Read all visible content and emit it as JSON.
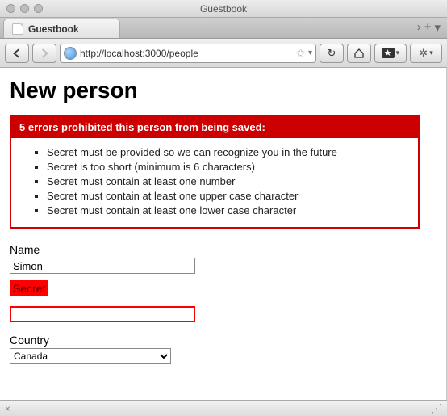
{
  "window": {
    "title": "Guestbook"
  },
  "tab": {
    "label": "Guestbook"
  },
  "toolbar": {
    "url": "http://localhost:3000/people"
  },
  "page": {
    "heading": "New person",
    "error_header": "5 errors prohibited this person from being saved:",
    "errors": [
      "Secret must be provided so we can recognize you in the future",
      "Secret is too short (minimum is 6 characters)",
      "Secret must contain at least one number",
      "Secret must contain at least one upper case character",
      "Secret must contain at least one lower case character"
    ],
    "fields": {
      "name": {
        "label": "Name",
        "value": "Simon"
      },
      "secret": {
        "label": "Secret",
        "value": ""
      },
      "country": {
        "label": "Country",
        "selected": "Canada"
      }
    }
  },
  "statusbar": {
    "close": "×"
  }
}
